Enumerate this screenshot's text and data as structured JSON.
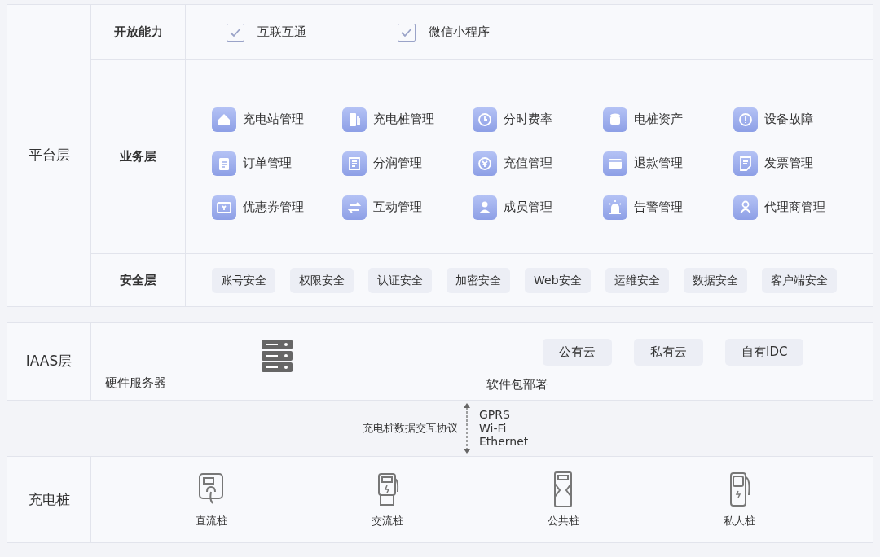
{
  "platform": {
    "label": "平台层",
    "open_capabilities": {
      "label": "开放能力",
      "items": [
        {
          "label": "互联互通",
          "checked": true
        },
        {
          "label": "微信小程序",
          "checked": true
        }
      ]
    },
    "business": {
      "label": "业务层",
      "modules": [
        "充电站管理",
        "充电桩管理",
        "分时费率",
        "电桩资产",
        "设备故障",
        "订单管理",
        "分润管理",
        "充值管理",
        "退款管理",
        "发票管理",
        "优惠券管理",
        "互动管理",
        "成员管理",
        "告警管理",
        "代理商管理"
      ]
    },
    "security": {
      "label": "安全层",
      "items": [
        "账号安全",
        "权限安全",
        "认证安全",
        "加密安全",
        "Web安全",
        "运维安全",
        "数据安全",
        "客户端安全"
      ]
    }
  },
  "iaas": {
    "label": "IAAS层",
    "hardware": {
      "label": "硬件服务器"
    },
    "software": {
      "label": "软件包部署",
      "options": [
        "公有云",
        "私有云",
        "自有IDC"
      ]
    }
  },
  "link": {
    "label": "充电桩数据交互协议",
    "protocols": [
      "GPRS",
      "Wi-Fi",
      "Ethernet"
    ]
  },
  "chargers": {
    "label": "充电桩",
    "items": [
      "直流桩",
      "交流桩",
      "公共桩",
      "私人桩"
    ]
  }
}
